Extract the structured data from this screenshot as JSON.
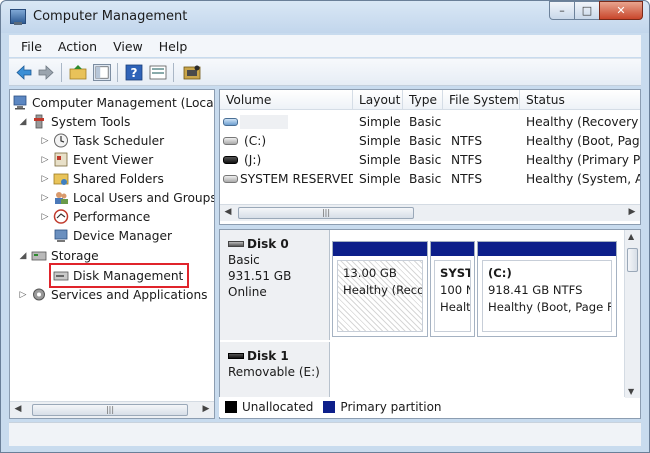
{
  "window": {
    "title": "Computer Management"
  },
  "caption": {
    "minimize": "–",
    "maximize": "□",
    "close": "✕"
  },
  "menu": [
    "File",
    "Action",
    "View",
    "Help"
  ],
  "tree": {
    "root": "Computer Management (Local",
    "system_tools": "System Tools",
    "items": [
      "Task Scheduler",
      "Event Viewer",
      "Shared Folders",
      "Local Users and Groups",
      "Performance",
      "Device Manager"
    ],
    "storage": "Storage",
    "disk_management": "Disk Management",
    "services": "Services and Applications"
  },
  "volume_table": {
    "columns": [
      "Volume",
      "Layout",
      "Type",
      "File System",
      "Status"
    ],
    "rows": [
      {
        "volume": "",
        "layout": "Simple",
        "type": "Basic",
        "fs": "",
        "status": "Healthy (Recovery P"
      },
      {
        "volume": "(C:)",
        "layout": "Simple",
        "type": "Basic",
        "fs": "NTFS",
        "status": "Healthy (Boot, Page"
      },
      {
        "volume": "(J:)",
        "layout": "Simple",
        "type": "Basic",
        "fs": "NTFS",
        "status": "Healthy (Primary Pa"
      },
      {
        "volume": "SYSTEM RESERVED",
        "layout": "Simple",
        "type": "Basic",
        "fs": "NTFS",
        "status": "Healthy (System, Ac"
      }
    ]
  },
  "disk0": {
    "name": "Disk 0",
    "type": "Basic",
    "size": "931.51 GB",
    "state": "Online",
    "partitions": [
      {
        "line1": "",
        "line2": "13.00 GB",
        "line3": "Healthy (Reco"
      },
      {
        "line1": "SYST",
        "line2": "100 N",
        "line3": "Healt"
      },
      {
        "line1": "(C:)",
        "line2": "918.41 GB NTFS",
        "line3": "Healthy (Boot, Page Fi"
      }
    ]
  },
  "disk1": {
    "name": "Disk 1",
    "type": "Removable (E:)"
  },
  "legend": {
    "unallocated": "Unallocated",
    "primary": "Primary partition"
  },
  "colors": {
    "primary": "#0d1f8a",
    "unallocated": "#000000",
    "highlight": "#e0242b"
  }
}
